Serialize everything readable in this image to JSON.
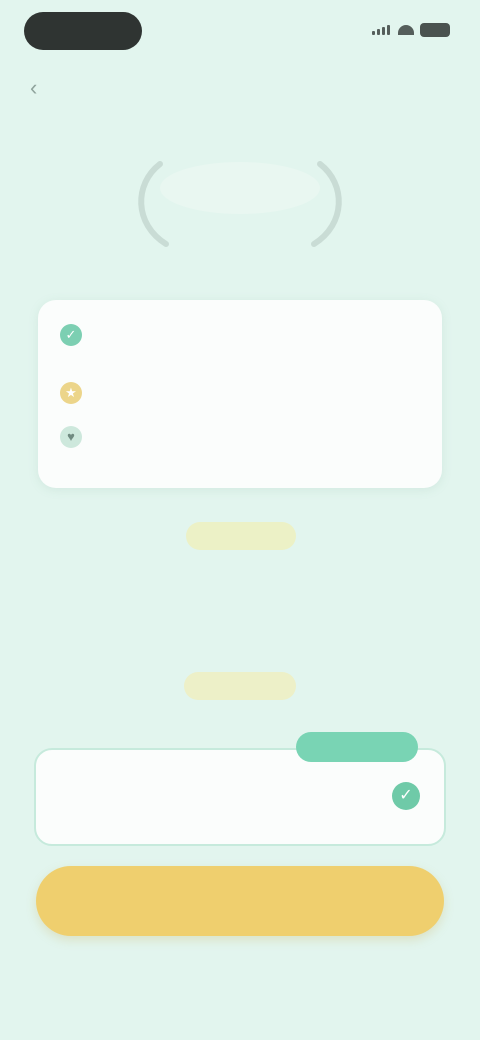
{
  "status_bar": {
    "time": "",
    "signal_icon": "signal-icon",
    "wifi_icon": "wifi-icon",
    "battery_icon": "battery-icon"
  },
  "nav": {
    "back_icon": "chevron-left-icon",
    "back_glyph": "‹"
  },
  "logo": {
    "title": "",
    "subtitle": ""
  },
  "features": [
    {
      "icon": "check-icon",
      "glyph": "✓",
      "text": ""
    },
    {
      "icon": "star-icon",
      "glyph": "★",
      "text": ""
    },
    {
      "icon": "heart-icon",
      "glyph": "♥",
      "text": ""
    }
  ],
  "offer": {
    "pill_top": "",
    "heading": "",
    "description": "",
    "pill_bottom": ""
  },
  "plan": {
    "badge": "",
    "name": "",
    "note": "",
    "price": "",
    "check_glyph": "✓"
  },
  "cta": {
    "label": ""
  },
  "restore": {
    "label": ""
  },
  "colors": {
    "background": "#e2f5ee",
    "accent_green": "#79d4b4",
    "accent_yellow": "#efcf6e"
  }
}
